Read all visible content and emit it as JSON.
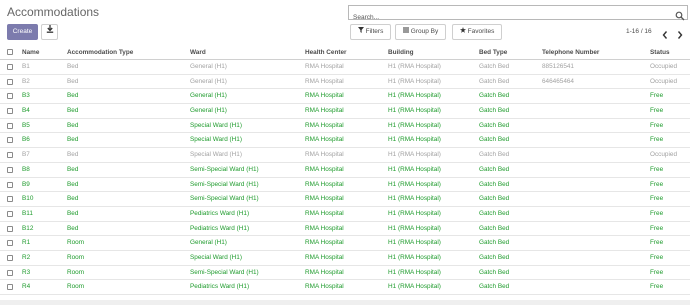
{
  "page": {
    "title": "Accommodations"
  },
  "search": {
    "placeholder": "Search..."
  },
  "toolbar": {
    "create_label": "Create",
    "filters_label": "Filters",
    "groupby_label": "Group By",
    "favorites_label": "Favorites"
  },
  "pager": {
    "text": "1-16 / 16"
  },
  "colors": {
    "accent": "#7c7bad",
    "free": "#1e9b2c",
    "occupied": "#a2a2a2"
  },
  "table": {
    "columns": [
      "Name",
      "Accommodation Type",
      "Ward",
      "Health Center",
      "Building",
      "Bed Type",
      "Telephone Number",
      "Status"
    ],
    "rows": [
      {
        "name": "B1",
        "type": "Bed",
        "ward": "General (H1)",
        "hc": "RMA Hospital",
        "building": "H1 (RMA Hospital)",
        "bed": "Gatch Bed",
        "tel": "885126541",
        "status": "Occupied"
      },
      {
        "name": "B2",
        "type": "Bed",
        "ward": "General (H1)",
        "hc": "RMA Hospital",
        "building": "H1 (RMA Hospital)",
        "bed": "Gatch Bed",
        "tel": "646465464",
        "status": "Occupied"
      },
      {
        "name": "B3",
        "type": "Bed",
        "ward": "General (H1)",
        "hc": "RMA Hospital",
        "building": "H1 (RMA Hospital)",
        "bed": "Gatch Bed",
        "tel": "",
        "status": "Free"
      },
      {
        "name": "B4",
        "type": "Bed",
        "ward": "General (H1)",
        "hc": "RMA Hospital",
        "building": "H1 (RMA Hospital)",
        "bed": "Gatch Bed",
        "tel": "",
        "status": "Free"
      },
      {
        "name": "B5",
        "type": "Bed",
        "ward": "Special Ward (H1)",
        "hc": "RMA Hospital",
        "building": "H1 (RMA Hospital)",
        "bed": "Gatch Bed",
        "tel": "",
        "status": "Free"
      },
      {
        "name": "B6",
        "type": "Bed",
        "ward": "Special Ward (H1)",
        "hc": "RMA Hospital",
        "building": "H1 (RMA Hospital)",
        "bed": "Gatch Bed",
        "tel": "",
        "status": "Free"
      },
      {
        "name": "B7",
        "type": "Bed",
        "ward": "Special Ward (H1)",
        "hc": "RMA Hospital",
        "building": "H1 (RMA Hospital)",
        "bed": "Gatch Bed",
        "tel": "",
        "status": "Occupied"
      },
      {
        "name": "B8",
        "type": "Bed",
        "ward": "Semi-Special Ward (H1)",
        "hc": "RMA Hospital",
        "building": "H1 (RMA Hospital)",
        "bed": "Gatch Bed",
        "tel": "",
        "status": "Free"
      },
      {
        "name": "B9",
        "type": "Bed",
        "ward": "Semi-Special Ward (H1)",
        "hc": "RMA Hospital",
        "building": "H1 (RMA Hospital)",
        "bed": "Gatch Bed",
        "tel": "",
        "status": "Free"
      },
      {
        "name": "B10",
        "type": "Bed",
        "ward": "Semi-Special Ward (H1)",
        "hc": "RMA Hospital",
        "building": "H1 (RMA Hospital)",
        "bed": "Gatch Bed",
        "tel": "",
        "status": "Free"
      },
      {
        "name": "B11",
        "type": "Bed",
        "ward": "Pediatrics Ward (H1)",
        "hc": "RMA Hospital",
        "building": "H1 (RMA Hospital)",
        "bed": "Gatch Bed",
        "tel": "",
        "status": "Free"
      },
      {
        "name": "B12",
        "type": "Bed",
        "ward": "Pediatrics Ward (H1)",
        "hc": "RMA Hospital",
        "building": "H1 (RMA Hospital)",
        "bed": "Gatch Bed",
        "tel": "",
        "status": "Free"
      },
      {
        "name": "R1",
        "type": "Room",
        "ward": "General (H1)",
        "hc": "RMA Hospital",
        "building": "H1 (RMA Hospital)",
        "bed": "Gatch Bed",
        "tel": "",
        "status": "Free"
      },
      {
        "name": "R2",
        "type": "Room",
        "ward": "Special Ward (H1)",
        "hc": "RMA Hospital",
        "building": "H1 (RMA Hospital)",
        "bed": "Gatch Bed",
        "tel": "",
        "status": "Free"
      },
      {
        "name": "R3",
        "type": "Room",
        "ward": "Semi-Special Ward (H1)",
        "hc": "RMA Hospital",
        "building": "H1 (RMA Hospital)",
        "bed": "Gatch Bed",
        "tel": "",
        "status": "Free"
      },
      {
        "name": "R4",
        "type": "Room",
        "ward": "Pediatrics Ward (H1)",
        "hc": "RMA Hospital",
        "building": "H1 (RMA Hospital)",
        "bed": "Gatch Bed",
        "tel": "",
        "status": "Free"
      }
    ]
  }
}
